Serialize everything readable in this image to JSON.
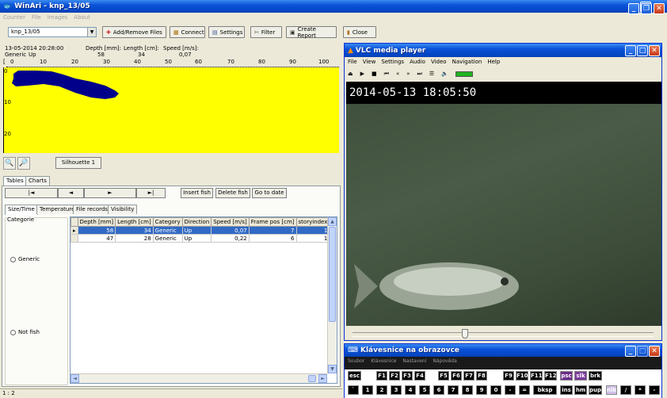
{
  "app": {
    "title": "WinAri - knp_13/05",
    "menu": [
      "Counter",
      "File",
      "Images",
      "About"
    ],
    "status": "1 : 2"
  },
  "toolbar": {
    "selected_file": "knp_13/05",
    "add_remove": "Add/Remove Files",
    "connect": "Connect",
    "settings": "Settings",
    "filter": "Filter",
    "create_report": "Create Report",
    "close": "Close"
  },
  "info": {
    "datetime": "13-05-2014 20:28:00",
    "category": "Generic",
    "direction": "Up",
    "depth_label": "Depth [mm]:",
    "depth_value": "58",
    "length_label": "Length [cm]:",
    "length_value": "34",
    "speed_label": "Speed [m/s]:",
    "speed_value": "0,07"
  },
  "ruler": {
    "ticks": [
      "0",
      "10",
      "20",
      "30",
      "40",
      "50",
      "60",
      "70",
      "80",
      "90",
      "100"
    ],
    "y_ticks": [
      "0",
      "10",
      "20"
    ]
  },
  "silhouette_button": "Silhouette 1",
  "tabs_top": [
    "Tables",
    "Charts"
  ],
  "nav": {
    "first": "|◄",
    "prev": "◄",
    "next": "►",
    "last": "►|",
    "insert": "Insert fish",
    "delete": "Delete fish",
    "goto": "Go to date"
  },
  "tabs_sub": [
    "Size/Time",
    "Temperature",
    "File records",
    "Visibility"
  ],
  "categorie": {
    "title": "Categorie",
    "generic": "Generic",
    "not_fish": "Not fish"
  },
  "grid": {
    "headers": [
      "Depth [mm]",
      "Length [cm]",
      "Category",
      "Direction",
      "Speed [m/s]",
      "Frame pos [cm]",
      "storyindex"
    ],
    "rows": [
      [
        "58",
        "34",
        "Generic",
        "Up",
        "0,07",
        "7",
        "1"
      ],
      [
        "47",
        "28",
        "Generic",
        "Up",
        "0,22",
        "6",
        "1"
      ]
    ]
  },
  "vlc": {
    "title": "VLC media player",
    "menu": [
      "File",
      "View",
      "Settings",
      "Audio",
      "Video",
      "Navigation",
      "Help"
    ],
    "timestamp": "2014-05-13 18:05:50"
  },
  "keyboard": {
    "title": "Klávesnice na obrazovce",
    "menu": [
      "Soubor",
      "Klávesnice",
      "Nastavení",
      "Nápověda"
    ],
    "row1": [
      "esc",
      "F1",
      "F2",
      "F3",
      "F4",
      "F5",
      "F6",
      "F7",
      "F8",
      "F9",
      "F10",
      "F11",
      "F12",
      "psc",
      "slk",
      "brk"
    ],
    "row2": [
      "`",
      "1",
      "2",
      "3",
      "4",
      "5",
      "6",
      "7",
      "8",
      "9",
      "0",
      "-",
      "=",
      "bksp",
      "ins",
      "hm",
      "pup",
      "nlk",
      "/",
      "*",
      "-"
    ]
  },
  "colors": {
    "plot_bg": "#ffff00",
    "fish_silhouette": "#00008b",
    "selection": "#316ac5",
    "xp_title": "#0a52d8"
  }
}
